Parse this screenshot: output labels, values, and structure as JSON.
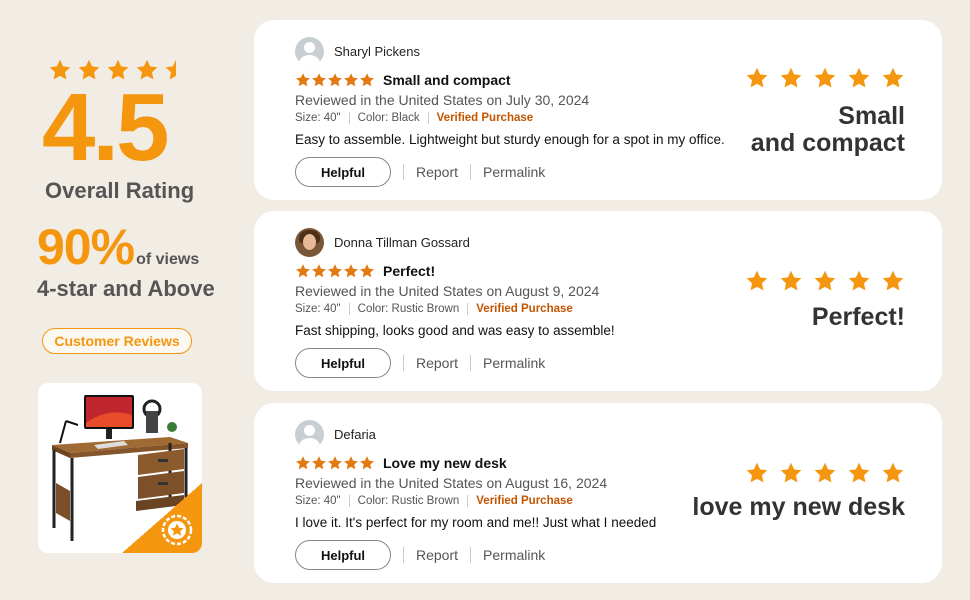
{
  "summary": {
    "score": "4.5",
    "score_label": "Overall Rating",
    "percent": "90%",
    "percent_suffix": "of views",
    "percent_label": "4-star and Above",
    "pill_label": "Customer Reviews",
    "star_rating": 4.5
  },
  "colors": {
    "accent": "#f5960f",
    "review_star": "#e47911",
    "verified": "#c45500",
    "background": "#f1ece4"
  },
  "reviews": [
    {
      "name": "Sharyl Pickens",
      "avatar": "default-avatar-icon",
      "rating": 5,
      "title": "Small and compact",
      "reviewed": "Reviewed in the United States on July 30, 2024",
      "size": "Size: 40\"",
      "color": "Color: Black",
      "verified": "Verified Purchase",
      "body": "Easy to assemble. Lightweight but sturdy enough for a spot in my office.",
      "helpful": "Helpful",
      "report": "Report",
      "permalink": "Permalink",
      "headline_line1": "Small",
      "headline_line2": "and compact"
    },
    {
      "name": "Donna Tillman Gossard",
      "avatar": "photo-avatar",
      "rating": 5,
      "title": "Perfect!",
      "reviewed": "Reviewed in the United States on August 9, 2024",
      "size": "Size: 40\"",
      "color": "Color: Rustic Brown",
      "verified": "Verified Purchase",
      "body": "Fast shipping, looks good and was easy to assemble!",
      "helpful": "Helpful",
      "report": "Report",
      "permalink": "Permalink",
      "headline_line1": "Perfect!",
      "headline_line2": ""
    },
    {
      "name": "Defaria",
      "avatar": "default-avatar-icon",
      "rating": 5,
      "title": "Love my new desk",
      "reviewed": "Reviewed in the United States on August 16, 2024",
      "size": "Size: 40\"",
      "color": "Color: Rustic Brown",
      "verified": "Verified Purchase",
      "body": "I love it. It's perfect for my room and me!! Just what I needed",
      "helpful": "Helpful",
      "report": "Report",
      "permalink": "Permalink",
      "headline_line1": "love my new desk",
      "headline_line2": ""
    }
  ]
}
